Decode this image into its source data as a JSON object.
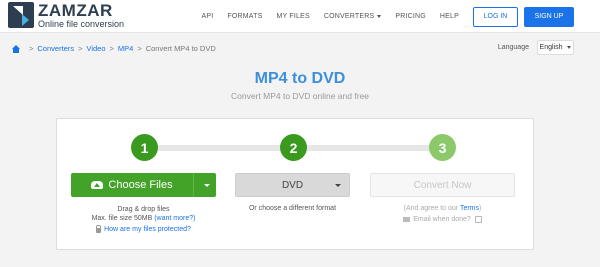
{
  "brand": {
    "name": "ZAMZAR",
    "tagline": "Online file conversion"
  },
  "nav": {
    "api": "API",
    "formats": "FORMATS",
    "my_files": "MY FILES",
    "converters": "CONVERTERS",
    "pricing": "PRICING",
    "help": "HELP",
    "login": "LOG IN",
    "signup": "SIGN UP"
  },
  "breadcrumb": {
    "items": [
      "Converters",
      "Video",
      "MP4"
    ],
    "current": "Convert MP4 to DVD",
    "separator": ">"
  },
  "language": {
    "label": "Language",
    "selected": "English"
  },
  "page": {
    "title": "MP4 to DVD",
    "subtitle": "Convert MP4 to DVD online and free"
  },
  "steps": [
    "1",
    "2",
    "3"
  ],
  "step1": {
    "button": "Choose Files",
    "drag_text": "Drag & drop files",
    "max_size": "Max. file size 50MB",
    "want_more": "(want more?)",
    "protected": "How are my files protected?"
  },
  "step2": {
    "selected_format": "DVD",
    "hint": "Or choose a different format"
  },
  "step3": {
    "button": "Convert Now",
    "agree_prefix": "(And agree to our ",
    "terms": "Terms",
    "agree_suffix": ")",
    "email_label": "Email when done?"
  },
  "colors": {
    "accent_blue": "#1a73e8",
    "title_blue": "#3d8fd9",
    "step_green": "#3a9a1d",
    "step_green_light": "#8cc96a",
    "button_green": "#43a329"
  }
}
